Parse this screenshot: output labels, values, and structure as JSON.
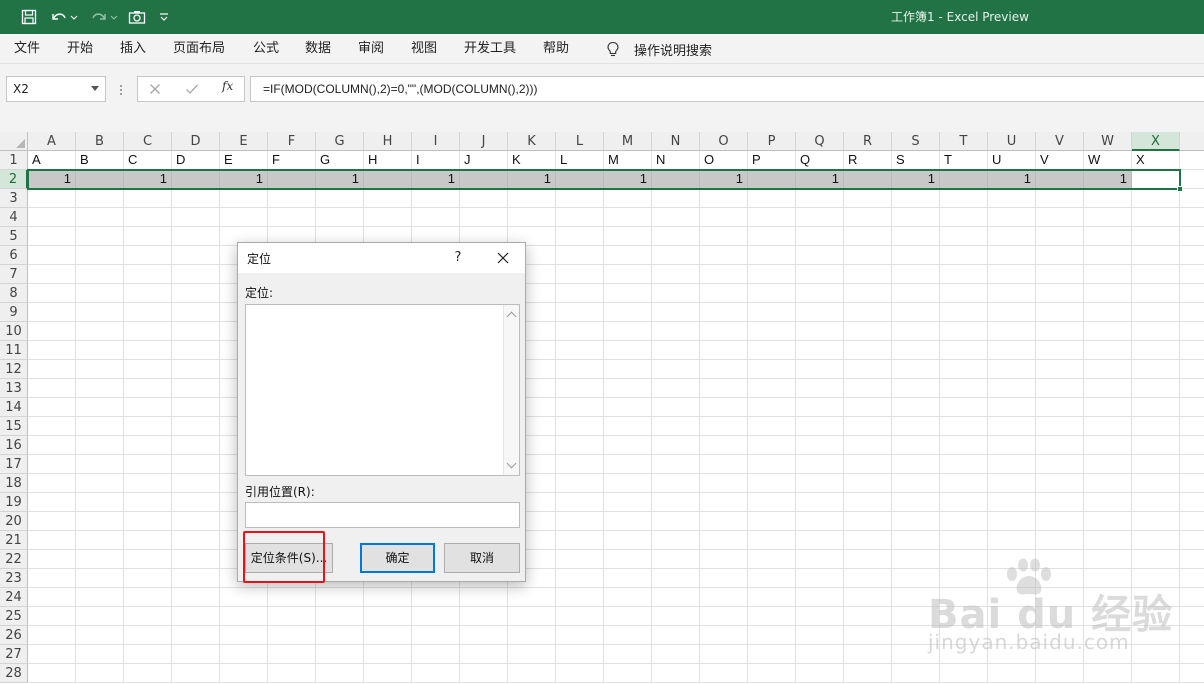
{
  "titlebar": {
    "title": "工作簿1  -  Excel Preview",
    "quick_access": [
      "save-icon",
      "undo-icon",
      "redo-icon",
      "camera-icon",
      "customize-icon"
    ]
  },
  "menu": {
    "items": [
      "文件",
      "开始",
      "插入",
      "页面布局",
      "公式",
      "数据",
      "审阅",
      "视图",
      "开发工具",
      "帮助"
    ],
    "tell_me": "操作说明搜索"
  },
  "formula_bar": {
    "name_box": "X2",
    "fx": "fx",
    "formula": "=IF(MOD(COLUMN(),2)=0,\"\",(MOD(COLUMN(),2)))"
  },
  "sheet": {
    "columns": [
      "A",
      "B",
      "C",
      "D",
      "E",
      "F",
      "G",
      "H",
      "I",
      "J",
      "K",
      "L",
      "M",
      "N",
      "O",
      "P",
      "Q",
      "R",
      "S",
      "T",
      "U",
      "V",
      "W",
      "X"
    ],
    "row_numbers": [
      "1",
      "2",
      "3",
      "4",
      "5",
      "6",
      "7",
      "8",
      "9",
      "10",
      "11",
      "12",
      "13",
      "14",
      "15",
      "16",
      "17",
      "18",
      "19",
      "20",
      "21",
      "22",
      "23",
      "24",
      "25",
      "26",
      "27",
      "28"
    ],
    "row1_values": [
      "A",
      "B",
      "C",
      "D",
      "E",
      "F",
      "G",
      "H",
      "I",
      "J",
      "K",
      "L",
      "M",
      "N",
      "O",
      "P",
      "Q",
      "R",
      "S",
      "T",
      "U",
      "V",
      "W",
      "X"
    ],
    "row2_values": [
      "1",
      "",
      "1",
      "",
      "1",
      "",
      "1",
      "",
      "1",
      "",
      "1",
      "",
      "1",
      "",
      "1",
      "",
      "1",
      "",
      "1",
      "",
      "1",
      "",
      "1",
      ""
    ],
    "selected_cell": "X2",
    "selected_row": "2",
    "selected_column": "X"
  },
  "dialog": {
    "title": "定位",
    "help": "?",
    "goto_label": "定位:",
    "reference_label": "引用位置(R):",
    "reference_value": "",
    "special_button": "定位条件(S)...",
    "ok_button": "确定",
    "cancel_button": "取消"
  },
  "watermark": {
    "brand": "Bai du 经验",
    "url": "jingyan.baidu.com"
  }
}
